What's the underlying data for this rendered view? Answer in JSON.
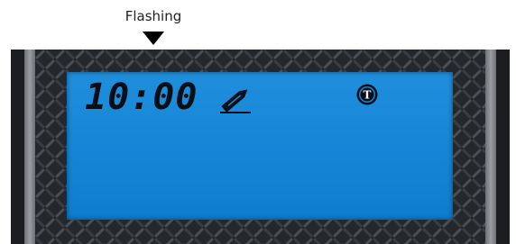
{
  "callout": {
    "label": "Flashing",
    "icon": "down-arrow-icon"
  },
  "display": {
    "time": "10:00",
    "edit_icon": "pencil-icon",
    "temperature_icon": "thermometer-circle-icon",
    "temperature_symbol": "T",
    "lcd_color": "#1485d6",
    "segment_color": "#0a0f17",
    "bezel_color": "#24272b"
  }
}
